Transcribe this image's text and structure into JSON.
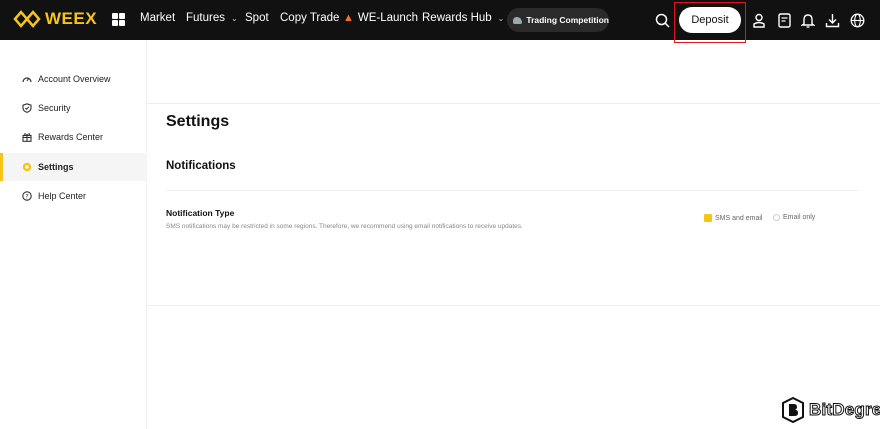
{
  "brand": {
    "logo_text": "WEEX",
    "accent_color": "#f5c518",
    "nav_bg": "#111111"
  },
  "nav": {
    "items": [
      {
        "label": "Market"
      },
      {
        "label": "Futures",
        "has_dropdown": true
      },
      {
        "label": "Spot"
      },
      {
        "label": "Copy Trade"
      },
      {
        "label": "WE-Launch",
        "icon": "flame-icon"
      },
      {
        "label": "Rewards Hub",
        "has_dropdown": true
      }
    ],
    "trading_competition": "Trading Competition",
    "deposit_label": "Deposit",
    "right_icons": [
      "search-icon",
      "user-icon",
      "orders-icon",
      "bell-icon",
      "download-icon",
      "globe-icon"
    ]
  },
  "sidebar": {
    "items": [
      {
        "label": "Account Overview",
        "icon": "gauge-icon",
        "active": false
      },
      {
        "label": "Security",
        "icon": "shield-icon",
        "active": false
      },
      {
        "label": "Rewards Center",
        "icon": "gift-icon",
        "active": false
      },
      {
        "label": "Settings",
        "icon": "settings-icon",
        "active": true
      },
      {
        "label": "Help Center",
        "icon": "help-icon",
        "active": false
      }
    ]
  },
  "main": {
    "title": "Settings",
    "section_title": "Notifications",
    "notification_type": {
      "label": "Notification Type",
      "description": "SMS notifications may be restricted in some regions. Therefore, we recommend using email notifications to receive updates.",
      "options": [
        {
          "label": "SMS and email",
          "selected": true
        },
        {
          "label": "Email only",
          "selected": false
        }
      ]
    }
  },
  "watermark": {
    "text": "BitDegree"
  }
}
